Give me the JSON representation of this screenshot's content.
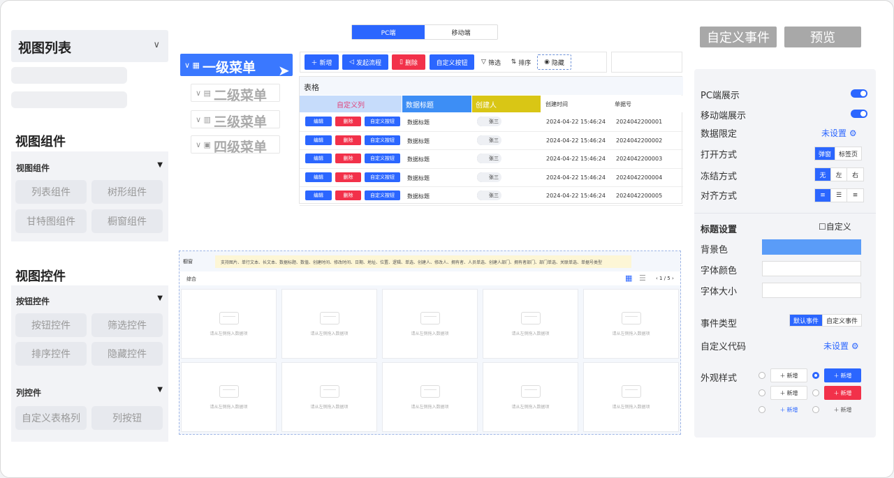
{
  "left_panel": {
    "view_list_title": "视图列表",
    "view_components_title": "视图组件",
    "view_components_group": "视图组件",
    "view_components": [
      "列表组件",
      "树形组件",
      "甘特图组件",
      "橱窗组件"
    ],
    "view_controls_title": "视图控件",
    "button_controls_group": "按钮控件",
    "button_controls": [
      "按钮控件",
      "筛选控件",
      "排序控件",
      "隐藏控件"
    ],
    "column_controls_group": "列控件",
    "column_controls": [
      "自定义表格列",
      "列按钮"
    ]
  },
  "tree": {
    "items": [
      "一级菜单",
      "二级菜单",
      "三级菜单",
      "四级菜单"
    ]
  },
  "device_tabs": [
    "PC端",
    "移动端"
  ],
  "toolbar": {
    "add": "新增",
    "start_flow": "发起流程",
    "delete": "删除",
    "custom_button": "自定义按钮",
    "filter": "筛选",
    "sort": "排序",
    "hide": "隐藏"
  },
  "table": {
    "title": "表格",
    "columns": [
      "自定义列",
      "数据标题",
      "创建人",
      "创建时间",
      "单据号"
    ],
    "header_colors": {
      "custom": "#c6dcfb",
      "title": "#3d8ef5",
      "creator": "#d9c615"
    },
    "row_actions": {
      "edit": "编辑",
      "delete": "删除",
      "custom": "自定义按钮"
    },
    "rows": [
      {
        "title": "数据标题",
        "creator": "张三",
        "created": "2024-04-22 15:46:24",
        "no": "2024042200001"
      },
      {
        "title": "数据标题",
        "creator": "张三",
        "created": "2024-04-22 15:46:24",
        "no": "2024042200002"
      },
      {
        "title": "数据标题",
        "creator": "张三",
        "created": "2024-04-22 15:46:24",
        "no": "2024042200003"
      },
      {
        "title": "数据标题",
        "creator": "张三",
        "created": "2024-04-22 15:46:24",
        "no": "2024042200004"
      },
      {
        "title": "数据标题",
        "creator": "张三",
        "created": "2024-04-22 15:46:24",
        "no": "2024042200005"
      }
    ]
  },
  "showcase": {
    "title": "橱窗",
    "hint": "支持图片、单行文本、长文本、数据标题、数值、创建时间、修改时间、日期、地址、位置、逻辑、单选、创建人、修改人、拥有者、人员单选、创建人部门、拥有者部门、部门单选、关联单选、单据号类型",
    "sort_label": "综合",
    "pager": "‹ 1 / 5 ›",
    "card_placeholder": "请从左侧拖入数据项",
    "card_count": 10
  },
  "top_buttons": {
    "custom_event": "自定义事件",
    "preview": "预览"
  },
  "settings": {
    "pc_display": "PC端展示",
    "mobile_display": "移动端展示",
    "data_limit": "数据限定",
    "not_set": "未设置",
    "open_mode": "打开方式",
    "open_options": [
      "弹窗",
      "标签页"
    ],
    "freeze_mode": "冻结方式",
    "freeze_options": [
      "无",
      "左",
      "右"
    ],
    "align_mode": "对齐方式",
    "align_options": [
      "≡",
      "☰",
      "≡"
    ],
    "title_settings": "标题设置",
    "custom_checkbox": "自定义",
    "bg_color": "背景色",
    "bg_color_value": "#5a9cf8",
    "font_color": "字体颜色",
    "font_size": "字体大小",
    "event_type": "事件类型",
    "event_options": [
      "默认事件",
      "自定义事件"
    ],
    "custom_code": "自定义代码",
    "appearance": "外观样式",
    "style_button_label": "新增"
  }
}
